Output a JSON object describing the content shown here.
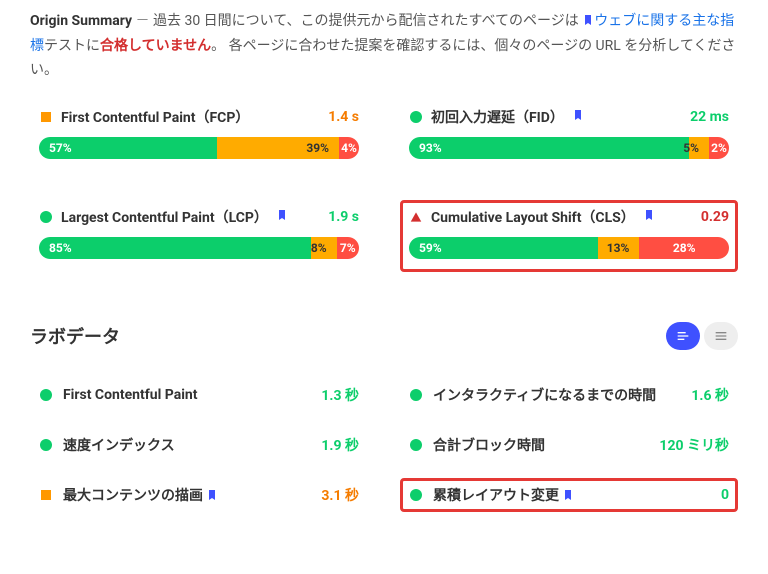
{
  "summary": {
    "title": "Origin Summary",
    "dash": "－",
    "text1": "過去 30 日間について、この提供元から配信されたすべてのページは",
    "linkText": "ウェブに関する主な指標",
    "text2": "テストに",
    "failText": "合格していません",
    "text3": "。  各ページに合わせた提案を確認するには、個々のページの URL を分析してください。"
  },
  "metrics": [
    {
      "name": "First Contentful Paint（FCP）",
      "bullet": "square-orange",
      "flag": false,
      "value": "1.4 s",
      "valClass": "val-orange",
      "segs": [
        57,
        39,
        4
      ],
      "hl": false
    },
    {
      "name": "初回入力遅延（FID）",
      "bullet": "circle-green",
      "flag": true,
      "value": "22 ms",
      "valClass": "val-green",
      "segs": [
        93,
        5,
        2
      ],
      "hl": false
    },
    {
      "name": "Largest Contentful Paint（LCP）",
      "bullet": "circle-green",
      "flag": true,
      "value": "1.9 s",
      "valClass": "val-green",
      "segs": [
        85,
        8,
        7
      ],
      "hl": false
    },
    {
      "name": "Cumulative Layout Shift（CLS）",
      "bullet": "triangle-red",
      "flag": true,
      "value": "0.29",
      "valClass": "val-red",
      "segs": [
        59,
        13,
        28
      ],
      "hl": true
    }
  ],
  "labSection": {
    "title": "ラボデータ"
  },
  "lab": {
    "left": [
      {
        "name": "First Contentful Paint",
        "bullet": "circle-green",
        "flag": false,
        "value": "1.3 秒",
        "valClass": "val-green",
        "hl": false
      },
      {
        "name": "速度インデックス",
        "bullet": "circle-green",
        "flag": false,
        "value": "1.9 秒",
        "valClass": "val-green",
        "hl": false
      },
      {
        "name": "最大コンテンツの描画",
        "bullet": "square-orange",
        "flag": true,
        "value": "3.1 秒",
        "valClass": "val-orange",
        "hl": false
      }
    ],
    "right": [
      {
        "name": "インタラクティブになるまでの時間",
        "bullet": "circle-green",
        "flag": false,
        "value": "1.6 秒",
        "valClass": "val-green",
        "hl": false
      },
      {
        "name": "合計ブロック時間",
        "bullet": "circle-green",
        "flag": false,
        "value": "120 ミリ秒",
        "valClass": "val-green",
        "hl": false
      },
      {
        "name": "累積レイアウト変更",
        "bullet": "circle-green",
        "flag": true,
        "value": "0",
        "valClass": "val-green",
        "hl": true
      }
    ]
  }
}
